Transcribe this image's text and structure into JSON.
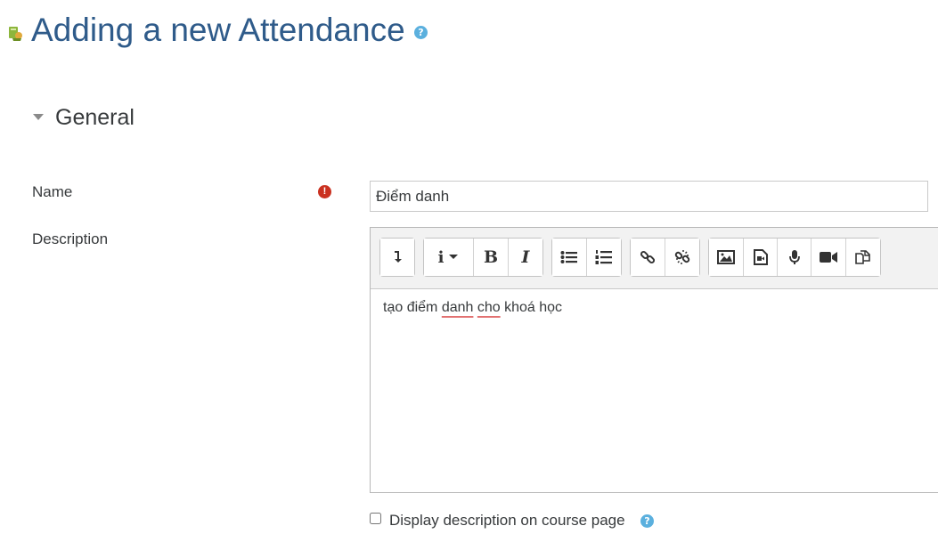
{
  "page": {
    "title": "Adding a new Attendance",
    "help_glyph": "?"
  },
  "section": {
    "title": "General"
  },
  "form": {
    "name_label": "Name",
    "required_glyph": "!",
    "name_value": "Điểm danh",
    "description_label": "Description",
    "description_text": {
      "part1": "tạo điểm ",
      "word_a": "danh",
      "space": " ",
      "word_b": "cho",
      "part2": " khoá học"
    },
    "display_on_course_label": "Display description on course page",
    "display_on_course_checked": false
  },
  "editor_toolbar": {
    "italic_glyph": "I",
    "bold_glyph": "B",
    "info_glyph": "i",
    "buttons": [
      "show-more-icon",
      "paragraph-style-icon",
      "bold-icon",
      "italic-icon",
      "unordered-list-icon",
      "ordered-list-icon",
      "link-icon",
      "unlink-icon",
      "image-icon",
      "media-icon",
      "record-audio-icon",
      "record-video-icon",
      "manage-files-icon"
    ]
  },
  "colors": {
    "title": "#2f5b8a",
    "help": "#5bb0de",
    "required": "#ca3120",
    "spellcheck_underline": "#e27171"
  }
}
